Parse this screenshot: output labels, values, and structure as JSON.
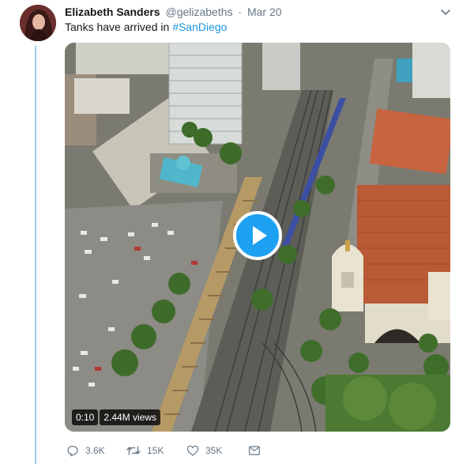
{
  "tweet": {
    "display_name": "Elizabeth Sanders",
    "handle": "@gelizabeths",
    "separator": "·",
    "date": "Mar 20",
    "text_prefix": "Tanks have arrived in ",
    "hashtag": "#SanDiego"
  },
  "video": {
    "duration": "0:10",
    "views": "2.44M views"
  },
  "actions": {
    "replies": "3.6K",
    "retweets": "15K",
    "likes": "35K"
  },
  "icons": {
    "reply": "reply-icon",
    "retweet": "retweet-icon",
    "like": "heart-icon",
    "dm": "envelope-icon",
    "caret": "chevron-down-icon",
    "play": "play-icon"
  },
  "colors": {
    "accent": "#1da1f2",
    "hashtag": "#1b95e0",
    "muted": "#657786",
    "text": "#14171a",
    "thread_line": "#9ccdf2"
  }
}
